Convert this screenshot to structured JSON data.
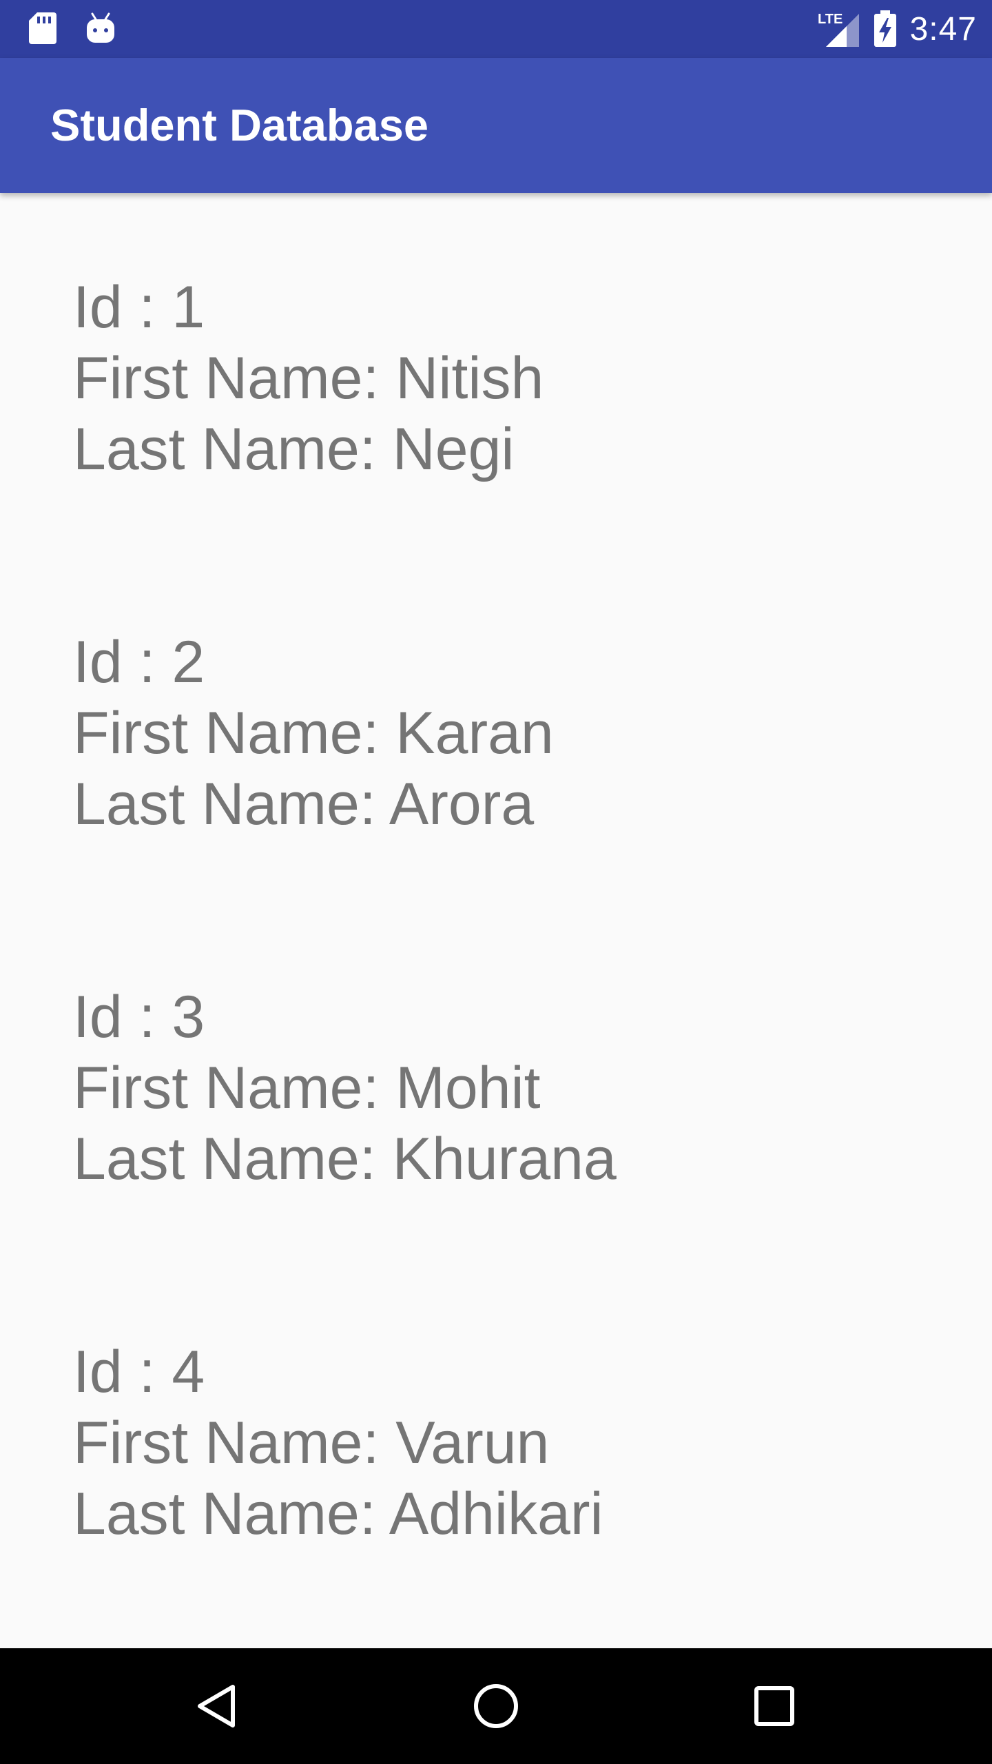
{
  "status_bar": {
    "left_icons": [
      "sd-card-icon",
      "android-icon"
    ],
    "right_icons": [
      "lte-signal-icon",
      "battery-charging-icon"
    ],
    "network_label": "LTE",
    "time": "3:47"
  },
  "app_bar": {
    "title": "Student Database",
    "color": "#3f51b5",
    "status_color": "#303f9f"
  },
  "records": [
    {
      "id_text": "Id : 1",
      "first_text": "First Name: Nitish",
      "last_text": "Last Name: Negi"
    },
    {
      "id_text": "Id : 2",
      "first_text": "First Name: Karan",
      "last_text": "Last Name: Arora"
    },
    {
      "id_text": "Id : 3",
      "first_text": "First Name: Mohit",
      "last_text": "Last Name: Khurana"
    },
    {
      "id_text": "Id : 4",
      "first_text": "First Name: Varun",
      "last_text": "Last Name: Adhikari"
    }
  ],
  "nav_bar": {
    "buttons": [
      "back-icon",
      "home-icon",
      "recents-icon"
    ]
  },
  "colors": {
    "text": "#757575",
    "background": "#fafafa"
  }
}
